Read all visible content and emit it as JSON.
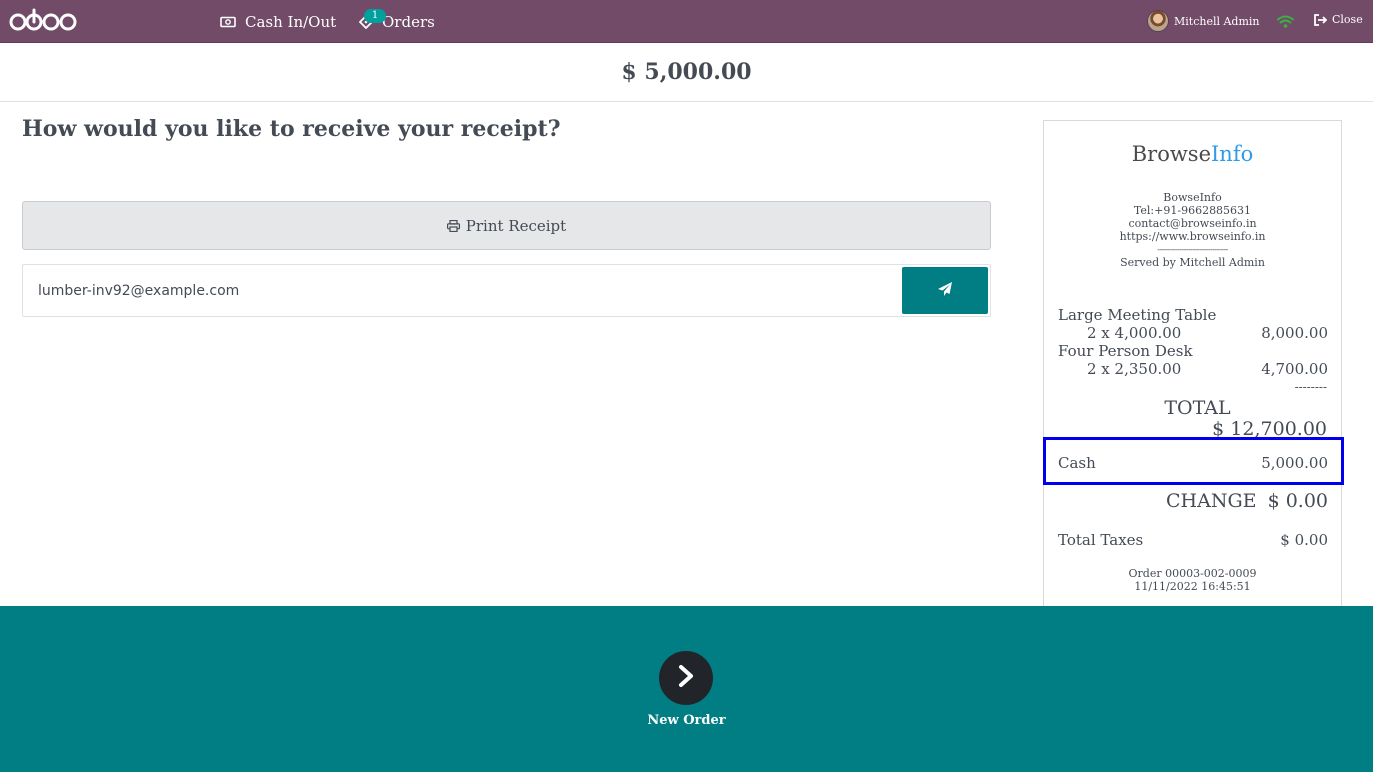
{
  "topbar": {
    "logo_text": "odoo",
    "cash_in_out_label": "Cash In/Out",
    "orders_label": "Orders",
    "orders_badge": "1",
    "user_name": "Mitchell Admin",
    "close_label": "Close",
    "colors": {
      "background": "#714b67",
      "badge": "#00a09d",
      "wifi": "#3cb043"
    }
  },
  "amount": "$ 5,000.00",
  "receipt_screen": {
    "question": "How would you like to receive your receipt?",
    "print_label": "Print Receipt",
    "email_value": "lumber-inv92@example.com",
    "send_icon": "paper-plane-icon",
    "send_color": "#017e84"
  },
  "receipt": {
    "brand_part1": "Browse",
    "brand_part2": "Info",
    "company_name": "BowseInfo",
    "phone": "Tel:+91-9662885631",
    "email": "contact@browseinfo.in",
    "website": "https://www.browseinfo.in",
    "separator": "--------------------------------",
    "served_by": "Served by Mitchell Admin",
    "lines": [
      {
        "product": "Large Meeting Table",
        "qty_price": "2 x 4,000.00",
        "total": "8,000.00"
      },
      {
        "product": "Four Person Desk",
        "qty_price": "2 x 2,350.00",
        "total": "4,700.00"
      }
    ],
    "total_separator": "--------",
    "total_label": "TOTAL",
    "total_value": "$ 12,700.00",
    "payment_label": "Cash",
    "payment_value": "5,000.00",
    "change_label": "CHANGE",
    "change_value": "$ 0.00",
    "taxes_label": "Total Taxes",
    "taxes_value": "$ 0.00",
    "order_ref": "Order 00003-002-0009",
    "order_date": "11/11/2022 16:45:51",
    "highlight_color": "#0000ee"
  },
  "footer": {
    "new_order_label": "New Order",
    "background": "#017e84"
  }
}
